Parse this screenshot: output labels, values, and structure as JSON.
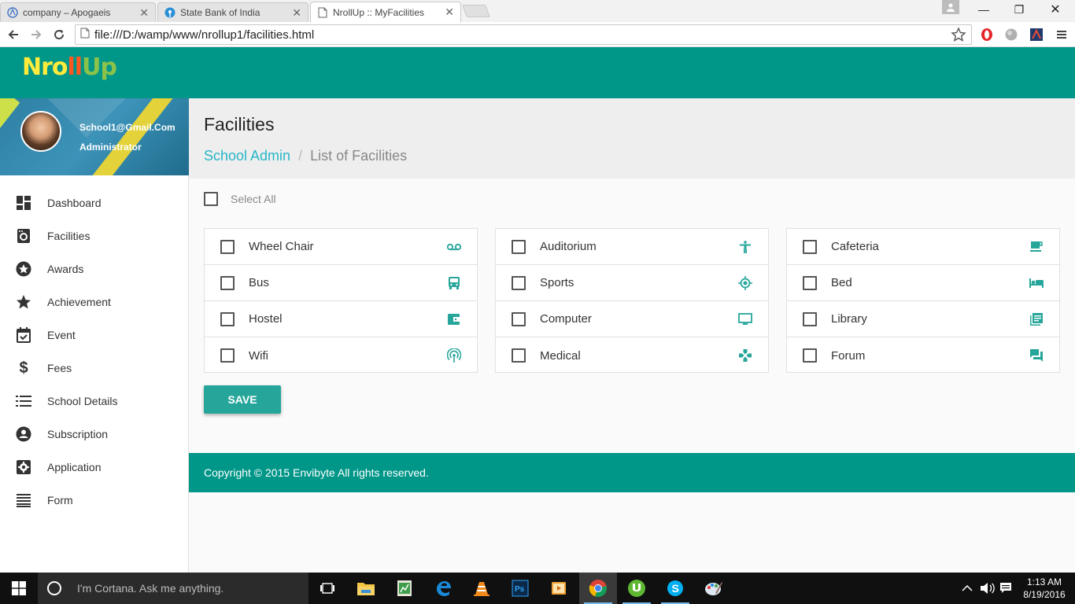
{
  "browser": {
    "tabs": [
      {
        "title": "company – Apogaeis",
        "active": false
      },
      {
        "title": "State Bank of India",
        "active": false
      },
      {
        "title": "NrollUp :: MyFacilities",
        "active": true
      }
    ],
    "url": "file:///D:/wamp/www/nrollup1/facilities.html"
  },
  "app": {
    "logo": {
      "part1": "Nro",
      "part2": "ll",
      "part3": "Up"
    },
    "user": {
      "email": "School1@Gmail.Com",
      "role": "Administrator"
    },
    "menu": [
      {
        "label": "Dashboard",
        "icon": "dashboard-icon"
      },
      {
        "label": "Facilities",
        "icon": "facilities-icon"
      },
      {
        "label": "Awards",
        "icon": "awards-icon"
      },
      {
        "label": "Achievement",
        "icon": "star-icon"
      },
      {
        "label": "Event",
        "icon": "event-icon"
      },
      {
        "label": "Fees",
        "icon": "dollar-icon"
      },
      {
        "label": "School Details",
        "icon": "list-icon"
      },
      {
        "label": "Subscription",
        "icon": "account-icon"
      },
      {
        "label": "Application",
        "icon": "settings-icon"
      },
      {
        "label": "Form",
        "icon": "form-icon"
      }
    ]
  },
  "page": {
    "title": "Facilities",
    "breadcrumb": {
      "root": "School Admin",
      "sep": "/",
      "current": "List of Facilities"
    },
    "select_all": "Select All",
    "columns": [
      [
        {
          "label": "Wheel Chair",
          "icon": "voicemail-icon"
        },
        {
          "label": "Bus",
          "icon": "bus-icon"
        },
        {
          "label": "Hostel",
          "icon": "wallet-icon"
        },
        {
          "label": "Wifi",
          "icon": "wifi-tethering-icon"
        }
      ],
      [
        {
          "label": "Auditorium",
          "icon": "accessibility-icon"
        },
        {
          "label": "Sports",
          "icon": "gps-icon"
        },
        {
          "label": "Computer",
          "icon": "monitor-icon"
        },
        {
          "label": "Medical",
          "icon": "gamepad-icon"
        }
      ],
      [
        {
          "label": "Cafeteria",
          "icon": "cafe-icon"
        },
        {
          "label": "Bed",
          "icon": "hotel-icon"
        },
        {
          "label": "Library",
          "icon": "library-icon"
        },
        {
          "label": "Forum",
          "icon": "forum-icon"
        }
      ]
    ],
    "save_label": "SAVE",
    "footer": "Copyright © 2015 Envibyte All rights reserved."
  },
  "taskbar": {
    "cortana_placeholder": "I'm Cortana. Ask me anything.",
    "time": "1:13 AM",
    "date": "8/19/2016"
  },
  "colors": {
    "primary": "#009688",
    "accent": "#26a69a",
    "link": "#29b6c6"
  }
}
